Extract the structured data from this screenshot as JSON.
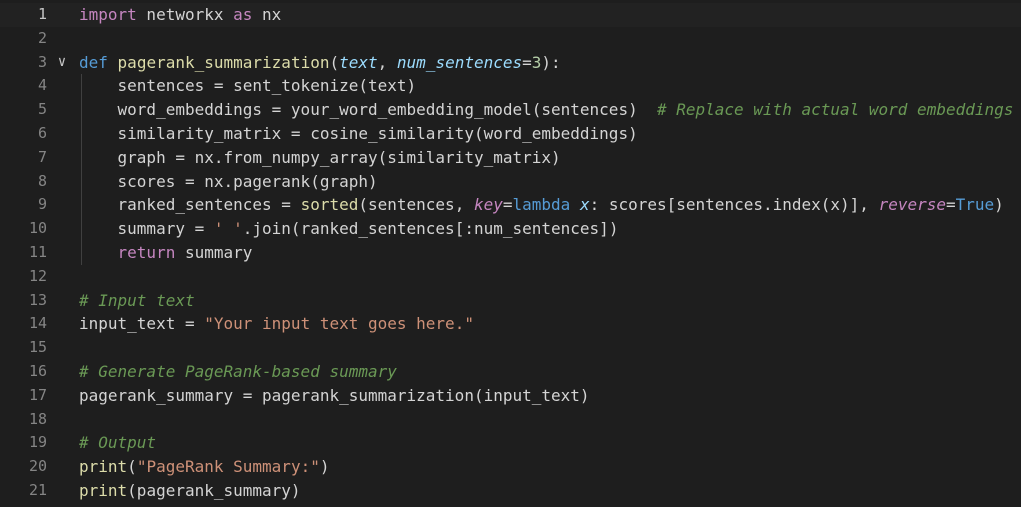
{
  "editor": {
    "line_numbers": [
      "1",
      "2",
      "3",
      "4",
      "5",
      "6",
      "7",
      "8",
      "9",
      "10",
      "11",
      "12",
      "13",
      "14",
      "15",
      "16",
      "17",
      "18",
      "19",
      "20",
      "21"
    ],
    "fold_glyph": "∨",
    "lines": [
      [
        {
          "t": "import",
          "c": "kw-ctrl"
        },
        {
          "t": " networkx ",
          "c": "op"
        },
        {
          "t": "as",
          "c": "kw-ctrl"
        },
        {
          "t": " nx",
          "c": "op"
        }
      ],
      [],
      [
        {
          "t": "def",
          "c": "kw"
        },
        {
          "t": " ",
          "c": "op"
        },
        {
          "t": "pagerank_summarization",
          "c": "fn"
        },
        {
          "t": "(",
          "c": "op"
        },
        {
          "t": "text",
          "c": "param"
        },
        {
          "t": ", ",
          "c": "op"
        },
        {
          "t": "num_sentences",
          "c": "param"
        },
        {
          "t": "=",
          "c": "op"
        },
        {
          "t": "3",
          "c": "num"
        },
        {
          "t": "):",
          "c": "op"
        }
      ],
      [
        {
          "t": "    sentences = sent_tokenize(text)",
          "c": "op"
        }
      ],
      [
        {
          "t": "    word_embeddings = your_word_embedding_model(sentences)  ",
          "c": "op"
        },
        {
          "t": "# Replace with actual word embeddings",
          "c": "cmt"
        }
      ],
      [
        {
          "t": "    similarity_matrix = cosine_similarity(word_embeddings)",
          "c": "op"
        }
      ],
      [
        {
          "t": "    graph = nx.from_numpy_array(similarity_matrix)",
          "c": "op"
        }
      ],
      [
        {
          "t": "    scores = nx.pagerank(graph)",
          "c": "op"
        }
      ],
      [
        {
          "t": "    ranked_sentences = ",
          "c": "op"
        },
        {
          "t": "sorted",
          "c": "fn"
        },
        {
          "t": "(sentences, ",
          "c": "op"
        },
        {
          "t": "key",
          "c": "kwarg"
        },
        {
          "t": "=",
          "c": "op"
        },
        {
          "t": "lambda",
          "c": "kw"
        },
        {
          "t": " ",
          "c": "op"
        },
        {
          "t": "x",
          "c": "param"
        },
        {
          "t": ": scores[sentences.index(x)], ",
          "c": "op"
        },
        {
          "t": "reverse",
          "c": "kwarg"
        },
        {
          "t": "=",
          "c": "op"
        },
        {
          "t": "True",
          "c": "kw"
        },
        {
          "t": ")",
          "c": "op"
        }
      ],
      [
        {
          "t": "    summary = ",
          "c": "op"
        },
        {
          "t": "' '",
          "c": "str"
        },
        {
          "t": ".join(ranked_sentences[:num_sentences])",
          "c": "op"
        }
      ],
      [
        {
          "t": "    ",
          "c": "op"
        },
        {
          "t": "return",
          "c": "kw-ctrl"
        },
        {
          "t": " summary",
          "c": "op"
        }
      ],
      [],
      [
        {
          "t": "# Input text",
          "c": "cmt"
        }
      ],
      [
        {
          "t": "input_text = ",
          "c": "op"
        },
        {
          "t": "\"Your input text goes here.\"",
          "c": "str"
        }
      ],
      [],
      [
        {
          "t": "# Generate PageRank-based summary",
          "c": "cmt"
        }
      ],
      [
        {
          "t": "pagerank_summary = pagerank_summarization(input_text)",
          "c": "op"
        }
      ],
      [],
      [
        {
          "t": "# Output",
          "c": "cmt"
        }
      ],
      [
        {
          "t": "print",
          "c": "fn"
        },
        {
          "t": "(",
          "c": "op"
        },
        {
          "t": "\"PageRank Summary:\"",
          "c": "str"
        },
        {
          "t": ")",
          "c": "op"
        }
      ],
      [
        {
          "t": "print",
          "c": "fn"
        },
        {
          "t": "(pagerank_summary)",
          "c": "op"
        }
      ]
    ]
  }
}
